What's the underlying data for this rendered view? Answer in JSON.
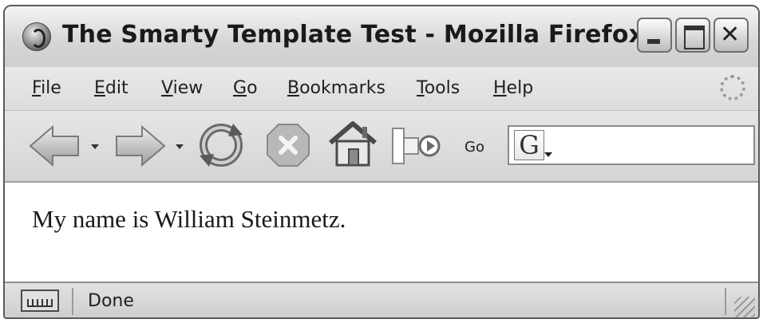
{
  "window": {
    "title": "The Smarty Template Test - Mozilla Firefox"
  },
  "menu": {
    "items": [
      {
        "label": "File",
        "accel": "F",
        "rest": "ile"
      },
      {
        "label": "Edit",
        "accel": "E",
        "rest": "dit"
      },
      {
        "label": "View",
        "accel": "V",
        "rest": "iew"
      },
      {
        "label": "Go",
        "accel": "G",
        "rest": "o"
      },
      {
        "label": "Bookmarks",
        "accel": "B",
        "rest": "ookmarks"
      },
      {
        "label": "Tools",
        "accel": "T",
        "rest": "ools"
      },
      {
        "label": "Help",
        "accel": "H",
        "rest": "elp"
      }
    ]
  },
  "toolbar": {
    "go_label": "Go",
    "search_engine_letter": "G",
    "icons": [
      "back-icon",
      "forward-icon",
      "reload-icon",
      "stop-icon",
      "home-icon",
      "address-go-icon"
    ]
  },
  "content": {
    "text": "My name is William Steinmetz."
  },
  "status": {
    "text": "Done"
  }
}
